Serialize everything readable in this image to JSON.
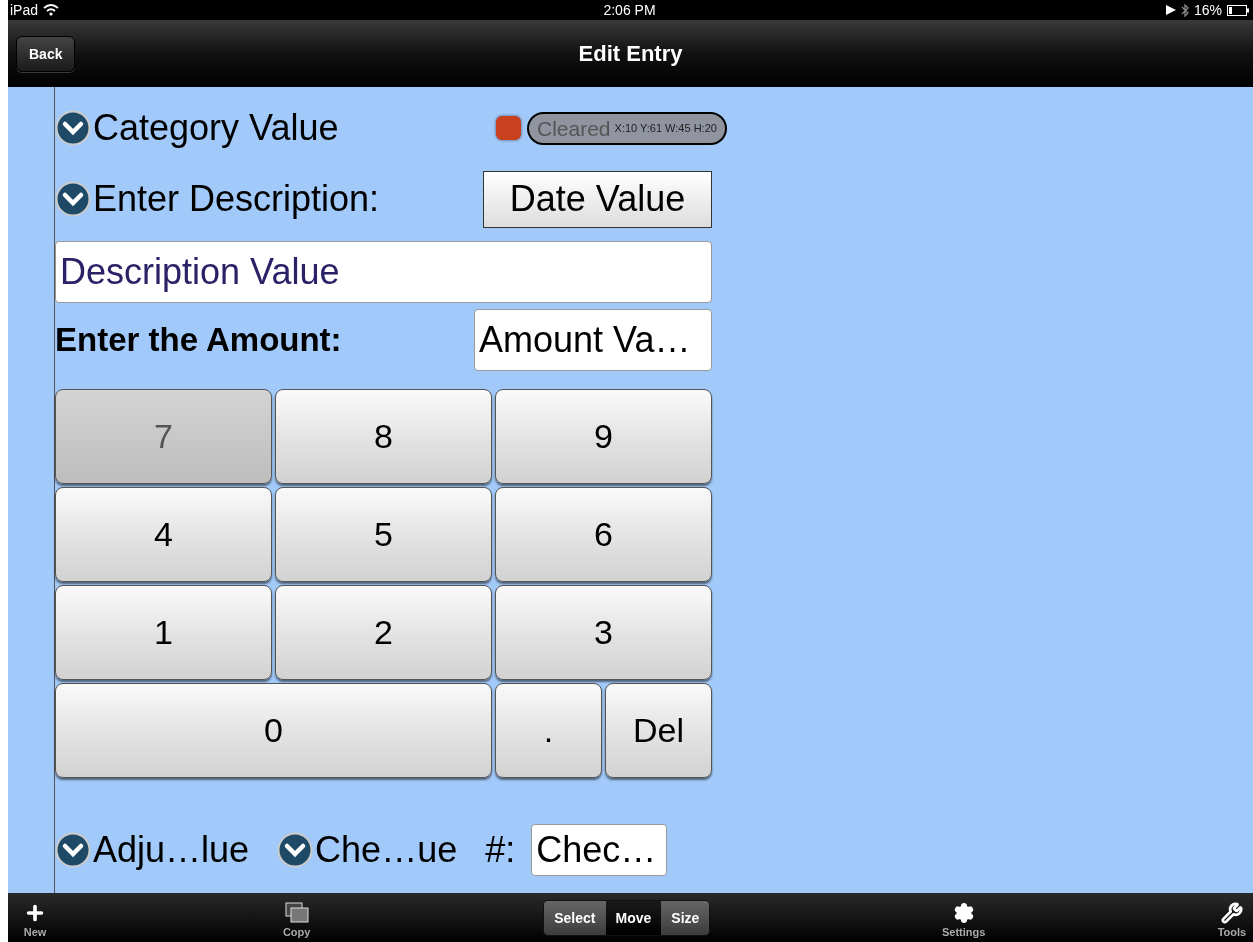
{
  "status_bar": {
    "device": "iPad",
    "time": "2:06 PM",
    "battery": "16%"
  },
  "nav_bar": {
    "back": "Back",
    "title": "Edit Entry"
  },
  "form": {
    "category": {
      "label": "Category Value",
      "cleared_label": "Cleared",
      "cleared_checked": true,
      "geometry": "X:10 Y:61 W:45 H:20"
    },
    "description_picker": {
      "label": "Enter Description:"
    },
    "date_button": "Date Value",
    "description_field": {
      "value": "Description Value"
    },
    "amount_label": "Enter the Amount:",
    "amount_field": {
      "value": "Amount Va…"
    },
    "keypad": [
      {
        "label": "7",
        "kind": "normal",
        "pressed": true
      },
      {
        "label": "8",
        "kind": "normal",
        "pressed": false
      },
      {
        "label": "9",
        "kind": "normal",
        "pressed": false
      },
      {
        "label": "4",
        "kind": "normal",
        "pressed": false
      },
      {
        "label": "5",
        "kind": "normal",
        "pressed": false
      },
      {
        "label": "6",
        "kind": "normal",
        "pressed": false
      },
      {
        "label": "1",
        "kind": "normal",
        "pressed": false
      },
      {
        "label": "2",
        "kind": "normal",
        "pressed": false
      },
      {
        "label": "3",
        "kind": "normal",
        "pressed": false
      },
      {
        "label": "0",
        "kind": "wide",
        "pressed": false
      },
      {
        "label": ".",
        "kind": "narrow",
        "pressed": false
      },
      {
        "label": "Del",
        "kind": "narrow",
        "pressed": false
      }
    ],
    "adjustment_picker": "Adju…lue",
    "cheque_picker": "Che…ue",
    "number_label": "#:",
    "cheque_field": {
      "value": "Chec…"
    }
  },
  "toolbar": {
    "items": [
      {
        "label": "New",
        "kind": "new"
      },
      {
        "label": "Copy",
        "kind": "copy"
      },
      {
        "label": "Settings",
        "kind": "settings"
      },
      {
        "label": "Tools",
        "kind": "tools"
      }
    ],
    "segments": [
      {
        "label": "Select",
        "selected": false
      },
      {
        "label": "Move",
        "selected": true
      },
      {
        "label": "Size",
        "selected": false
      }
    ]
  }
}
